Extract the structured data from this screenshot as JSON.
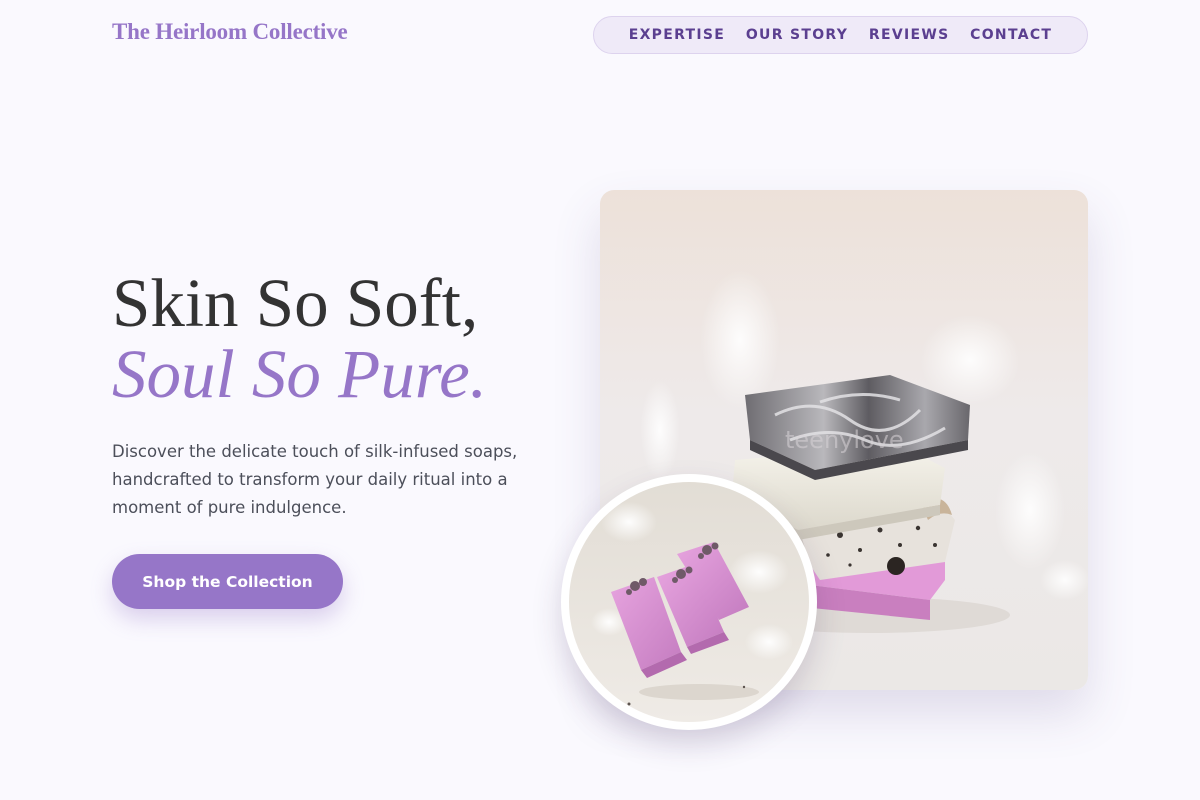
{
  "brand": {
    "name": "The Heirloom Collective"
  },
  "nav": {
    "items": [
      {
        "label": "EXPERTISE"
      },
      {
        "label": "OUR STORY"
      },
      {
        "label": "REVIEWS"
      },
      {
        "label": "CONTACT"
      }
    ]
  },
  "hero": {
    "headline_line1": "Skin So Soft,",
    "headline_line2": "Soul So Pure.",
    "description": "Discover the delicate touch of silk-infused soaps, handcrafted to transform your daily ritual into a moment of pure indulgence.",
    "cta_label": "Shop the Collection"
  },
  "colors": {
    "accent": "#9676c8",
    "nav_text": "#5b3f90",
    "nav_bg": "#efeaf8",
    "page_bg": "#faf9fe",
    "heading": "#333333",
    "body_text": "#4c4f5a"
  }
}
